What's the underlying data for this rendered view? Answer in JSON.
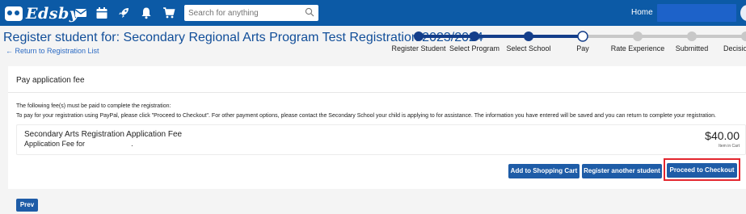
{
  "app": {
    "logo_text": "Edsby",
    "nav_icons": [
      "mail-icon",
      "calendar-icon",
      "rocket-icon",
      "bell-icon",
      "cart-icon"
    ],
    "search_placeholder": "Search for anything",
    "home_label": "Home"
  },
  "header": {
    "title": "Register student for: Secondary Regional Arts Program Test Registration 2023/2024",
    "back_link": "← Return to Registration List"
  },
  "stepper": {
    "steps": [
      {
        "label": "Register Student",
        "state": "done"
      },
      {
        "label": "Select Program",
        "state": "done"
      },
      {
        "label": "Select School",
        "state": "done"
      },
      {
        "label": "Pay",
        "state": "current"
      },
      {
        "label": "Rate Experience",
        "state": "todo"
      },
      {
        "label": "Submitted",
        "state": "todo"
      },
      {
        "label": "Decision",
        "state": "todo"
      }
    ],
    "colors": {
      "done": "#143e8a",
      "todo": "#c8c8c8",
      "current_fill": "#ffffff"
    }
  },
  "card": {
    "heading": "Pay application fee",
    "info_line1": "The following fee(s) must be paid to complete the registration:",
    "info_line2": "To pay for your registration using PayPal, please click \"Proceed to Checkout\".  For other payment options, please contact the Secondary School your child is applying to for assistance.  The information you have entered will be saved and you can return to complete your registration.",
    "fee": {
      "title": "Secondary Arts Registration Application Fee",
      "subtitle_prefix": "Application Fee for",
      "subtitle_suffix": ".",
      "amount": "$40.00",
      "status": "Item in Cart"
    }
  },
  "actions": {
    "add_to_cart": "Add to Shopping Cart",
    "register_another": "Register another student",
    "proceed_checkout": "Proceed to Checkout",
    "prev": "Prev"
  },
  "colors": {
    "topbar": "#0c5aa6",
    "title": "#114e99",
    "button": "#1e5ca7",
    "highlight": "#e3262e"
  }
}
